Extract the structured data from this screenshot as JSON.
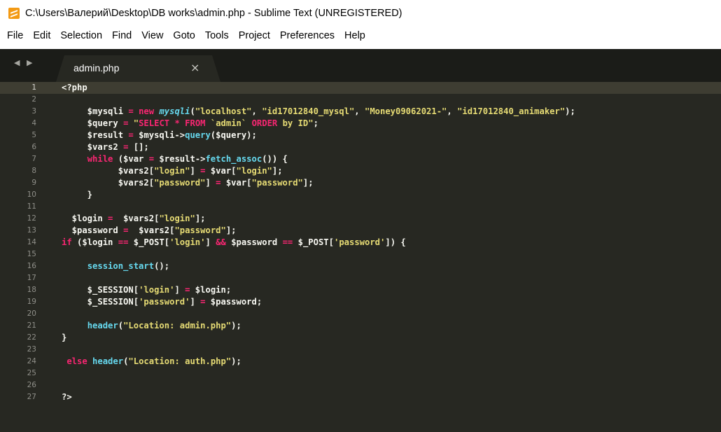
{
  "window": {
    "title": "C:\\Users\\Валерий\\Desktop\\DB works\\admin.php - Sublime Text (UNREGISTERED)",
    "icon": "sublime-text-icon"
  },
  "menu": [
    "File",
    "Edit",
    "Selection",
    "Find",
    "View",
    "Goto",
    "Tools",
    "Project",
    "Preferences",
    "Help"
  ],
  "tabs": {
    "nav_arrows": "◀ ▶",
    "active": {
      "label": "admin.php",
      "close": "×"
    }
  },
  "colors": {
    "editor_bg": "#272822",
    "tabbar_bg": "#1b1c18",
    "keyword": "#f92672",
    "string": "#e6db74",
    "function": "#66d9ef",
    "text": "#f8f8f2",
    "line_number": "#90908a"
  },
  "editor": {
    "active_line": 1,
    "lines": [
      {
        "n": "1",
        "tokens": [
          [
            "t-plain",
            "<?php"
          ]
        ]
      },
      {
        "n": "2",
        "tokens": []
      },
      {
        "n": "3",
        "tokens": [
          [
            "t-plain",
            "     $mysqli "
          ],
          [
            "t-op",
            "="
          ],
          [
            "t-plain",
            " "
          ],
          [
            "t-kw",
            "new"
          ],
          [
            "t-plain",
            " "
          ],
          [
            "t-cls",
            "mysqli"
          ],
          [
            "t-plain",
            "("
          ],
          [
            "t-str",
            "\"localhost\""
          ],
          [
            "t-plain",
            ", "
          ],
          [
            "t-str",
            "\"id17012840_mysql\""
          ],
          [
            "t-plain",
            ", "
          ],
          [
            "t-str",
            "\"Money09062021-\""
          ],
          [
            "t-plain",
            ", "
          ],
          [
            "t-str",
            "\"id17012840_animaker\""
          ],
          [
            "t-plain",
            ");"
          ]
        ]
      },
      {
        "n": "4",
        "tokens": [
          [
            "t-plain",
            "     $query "
          ],
          [
            "t-op",
            "="
          ],
          [
            "t-plain",
            " "
          ],
          [
            "t-str",
            "\""
          ],
          [
            "t-kw",
            "SELECT"
          ],
          [
            "t-str",
            " "
          ],
          [
            "t-kw",
            "*"
          ],
          [
            "t-str",
            " "
          ],
          [
            "t-kw",
            "FROM"
          ],
          [
            "t-str",
            " `admin` "
          ],
          [
            "t-kw",
            "ORDER"
          ],
          [
            "t-str",
            " by ID\""
          ],
          [
            "t-plain",
            ";"
          ]
        ]
      },
      {
        "n": "5",
        "tokens": [
          [
            "t-plain",
            "     $result "
          ],
          [
            "t-op",
            "="
          ],
          [
            "t-plain",
            " $mysqli->"
          ],
          [
            "t-fn",
            "query"
          ],
          [
            "t-plain",
            "($query);"
          ]
        ]
      },
      {
        "n": "6",
        "tokens": [
          [
            "t-plain",
            "     $vars2 "
          ],
          [
            "t-op",
            "="
          ],
          [
            "t-plain",
            " [];"
          ]
        ]
      },
      {
        "n": "7",
        "tokens": [
          [
            "t-plain",
            "     "
          ],
          [
            "t-kw",
            "while"
          ],
          [
            "t-plain",
            " ($var "
          ],
          [
            "t-op",
            "="
          ],
          [
            "t-plain",
            " $result->"
          ],
          [
            "t-fn",
            "fetch_assoc"
          ],
          [
            "t-plain",
            "()) {"
          ]
        ]
      },
      {
        "n": "8",
        "tokens": [
          [
            "t-plain",
            "           $vars2["
          ],
          [
            "t-str",
            "\"login\""
          ],
          [
            "t-plain",
            "] "
          ],
          [
            "t-op",
            "="
          ],
          [
            "t-plain",
            " $var["
          ],
          [
            "t-str",
            "\"login\""
          ],
          [
            "t-plain",
            "];"
          ]
        ]
      },
      {
        "n": "9",
        "tokens": [
          [
            "t-plain",
            "           $vars2["
          ],
          [
            "t-str",
            "\"password\""
          ],
          [
            "t-plain",
            "] "
          ],
          [
            "t-op",
            "="
          ],
          [
            "t-plain",
            " $var["
          ],
          [
            "t-str",
            "\"password\""
          ],
          [
            "t-plain",
            "];"
          ]
        ]
      },
      {
        "n": "10",
        "tokens": [
          [
            "t-plain",
            "     }"
          ]
        ]
      },
      {
        "n": "11",
        "tokens": []
      },
      {
        "n": "12",
        "tokens": [
          [
            "t-plain",
            "  $login "
          ],
          [
            "t-op",
            "="
          ],
          [
            "t-plain",
            "  $vars2["
          ],
          [
            "t-str",
            "\"login\""
          ],
          [
            "t-plain",
            "];"
          ]
        ]
      },
      {
        "n": "13",
        "tokens": [
          [
            "t-plain",
            "  $password "
          ],
          [
            "t-op",
            "="
          ],
          [
            "t-plain",
            "  $vars2["
          ],
          [
            "t-str",
            "\"password\""
          ],
          [
            "t-plain",
            "];"
          ]
        ]
      },
      {
        "n": "14",
        "tokens": [
          [
            "t-kw",
            "if"
          ],
          [
            "t-plain",
            " ($login "
          ],
          [
            "t-op",
            "=="
          ],
          [
            "t-plain",
            " $_POST["
          ],
          [
            "t-str",
            "'login'"
          ],
          [
            "t-plain",
            "] "
          ],
          [
            "t-op",
            "&&"
          ],
          [
            "t-plain",
            " $password "
          ],
          [
            "t-op",
            "=="
          ],
          [
            "t-plain",
            " $_POST["
          ],
          [
            "t-str",
            "'password'"
          ],
          [
            "t-plain",
            "]) {"
          ]
        ]
      },
      {
        "n": "15",
        "tokens": []
      },
      {
        "n": "16",
        "tokens": [
          [
            "t-plain",
            "     "
          ],
          [
            "t-fn",
            "session_start"
          ],
          [
            "t-plain",
            "();"
          ]
        ]
      },
      {
        "n": "17",
        "tokens": []
      },
      {
        "n": "18",
        "tokens": [
          [
            "t-plain",
            "     $_SESSION["
          ],
          [
            "t-str",
            "'login'"
          ],
          [
            "t-plain",
            "] "
          ],
          [
            "t-op",
            "="
          ],
          [
            "t-plain",
            " $login;"
          ]
        ]
      },
      {
        "n": "19",
        "tokens": [
          [
            "t-plain",
            "     $_SESSION["
          ],
          [
            "t-str",
            "'password'"
          ],
          [
            "t-plain",
            "] "
          ],
          [
            "t-op",
            "="
          ],
          [
            "t-plain",
            " $password;"
          ]
        ]
      },
      {
        "n": "20",
        "tokens": []
      },
      {
        "n": "21",
        "tokens": [
          [
            "t-plain",
            "     "
          ],
          [
            "t-fn",
            "header"
          ],
          [
            "t-plain",
            "("
          ],
          [
            "t-str",
            "\"Location: admin.php\""
          ],
          [
            "t-plain",
            ");"
          ]
        ]
      },
      {
        "n": "22",
        "tokens": [
          [
            "t-plain",
            "}"
          ]
        ]
      },
      {
        "n": "23",
        "tokens": []
      },
      {
        "n": "24",
        "tokens": [
          [
            "t-plain",
            " "
          ],
          [
            "t-kw",
            "else"
          ],
          [
            "t-plain",
            " "
          ],
          [
            "t-fn",
            "header"
          ],
          [
            "t-plain",
            "("
          ],
          [
            "t-str",
            "\"Location: auth.php\""
          ],
          [
            "t-plain",
            ");"
          ]
        ]
      },
      {
        "n": "25",
        "tokens": []
      },
      {
        "n": "26",
        "tokens": []
      },
      {
        "n": "27",
        "tokens": [
          [
            "t-plain",
            "?>"
          ]
        ]
      }
    ]
  }
}
